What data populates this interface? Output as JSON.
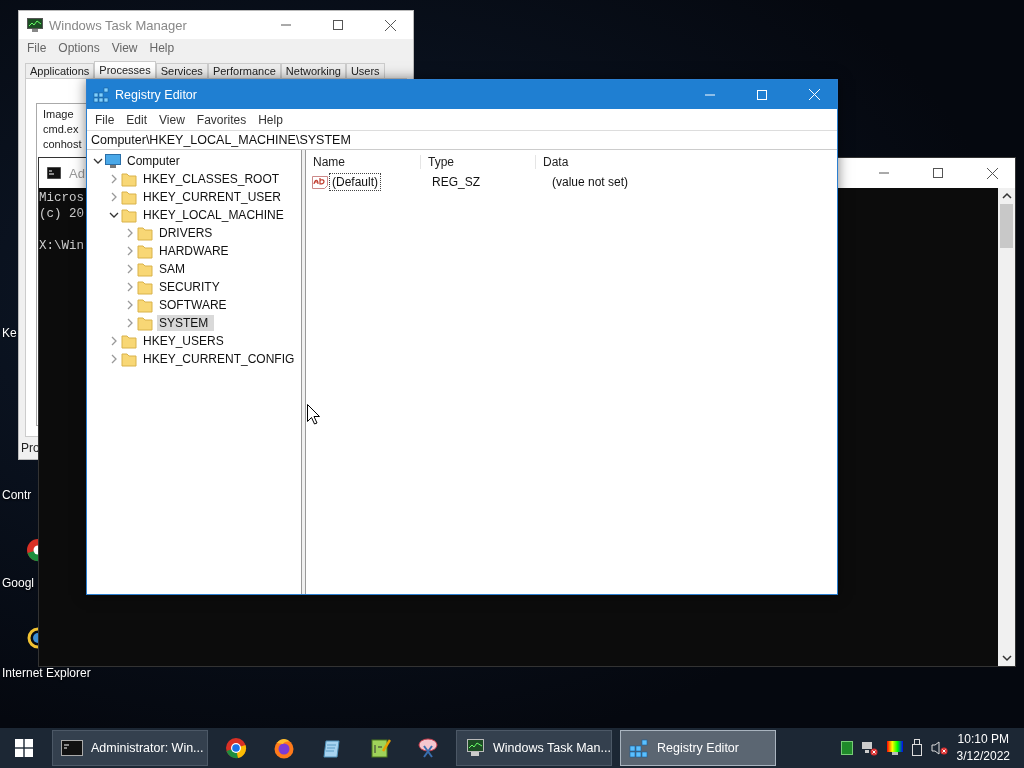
{
  "desktop_icons": [
    {
      "label": "Ke"
    },
    {
      "label": "Contr"
    },
    {
      "label": "Googl"
    },
    {
      "label": "Internet Explorer"
    }
  ],
  "task_manager": {
    "title": "Windows Task Manager",
    "menu": [
      "File",
      "Options",
      "View",
      "Help"
    ],
    "tabs": [
      {
        "label": "Applications",
        "selected": false
      },
      {
        "label": "Processes",
        "selected": true
      },
      {
        "label": "Services",
        "selected": false
      },
      {
        "label": "Performance",
        "selected": false
      },
      {
        "label": "Networking",
        "selected": false
      },
      {
        "label": "Users",
        "selected": false
      }
    ],
    "column": "Image",
    "rows": [
      "cmd.ex",
      "conhost"
    ],
    "status": "Pro"
  },
  "console": {
    "title": "Ad",
    "lines": [
      "Micros",
      "(c) 20"
    ],
    "prompt": "X:\\Win"
  },
  "registry_editor": {
    "title": "Registry Editor",
    "menu": [
      "File",
      "Edit",
      "View",
      "Favorites",
      "Help"
    ],
    "address": "Computer\\HKEY_LOCAL_MACHINE\\SYSTEM",
    "tree": [
      {
        "label": "Computer",
        "kind": "computer",
        "expanded": true,
        "selected": false,
        "children": [
          {
            "label": "HKEY_CLASSES_ROOT",
            "kind": "folder",
            "expanded": false,
            "selected": false
          },
          {
            "label": "HKEY_CURRENT_USER",
            "kind": "folder",
            "expanded": false,
            "selected": false
          },
          {
            "label": "HKEY_LOCAL_MACHINE",
            "kind": "folder",
            "expanded": true,
            "selected": false,
            "children": [
              {
                "label": "DRIVERS",
                "kind": "folder",
                "expanded": false,
                "selected": false
              },
              {
                "label": "HARDWARE",
                "kind": "folder",
                "expanded": false,
                "selected": false
              },
              {
                "label": "SAM",
                "kind": "folder",
                "expanded": false,
                "selected": false
              },
              {
                "label": "SECURITY",
                "kind": "folder",
                "expanded": false,
                "selected": false
              },
              {
                "label": "SOFTWARE",
                "kind": "folder",
                "expanded": false,
                "selected": false
              },
              {
                "label": "SYSTEM",
                "kind": "folder",
                "expanded": false,
                "selected": true
              }
            ]
          },
          {
            "label": "HKEY_USERS",
            "kind": "folder",
            "expanded": false,
            "selected": false
          },
          {
            "label": "HKEY_CURRENT_CONFIG",
            "kind": "folder",
            "expanded": false,
            "selected": false
          }
        ]
      }
    ],
    "columns": [
      "Name",
      "Type",
      "Data"
    ],
    "values": [
      {
        "name": "(Default)",
        "type": "REG_SZ",
        "data": "(value not set)",
        "selected": true
      }
    ]
  },
  "taskbar": {
    "items": [
      {
        "kind": "window",
        "label": "Administrator: Win...",
        "selected": false
      },
      {
        "kind": "pinned"
      },
      {
        "kind": "pinned"
      },
      {
        "kind": "pinned"
      },
      {
        "kind": "pinned"
      },
      {
        "kind": "pinned"
      },
      {
        "kind": "window",
        "label": "Windows Task Man...",
        "selected": false
      },
      {
        "kind": "window",
        "label": "Registry Editor",
        "selected": true
      }
    ],
    "time": "10:10 PM",
    "date": "3/12/2022"
  }
}
